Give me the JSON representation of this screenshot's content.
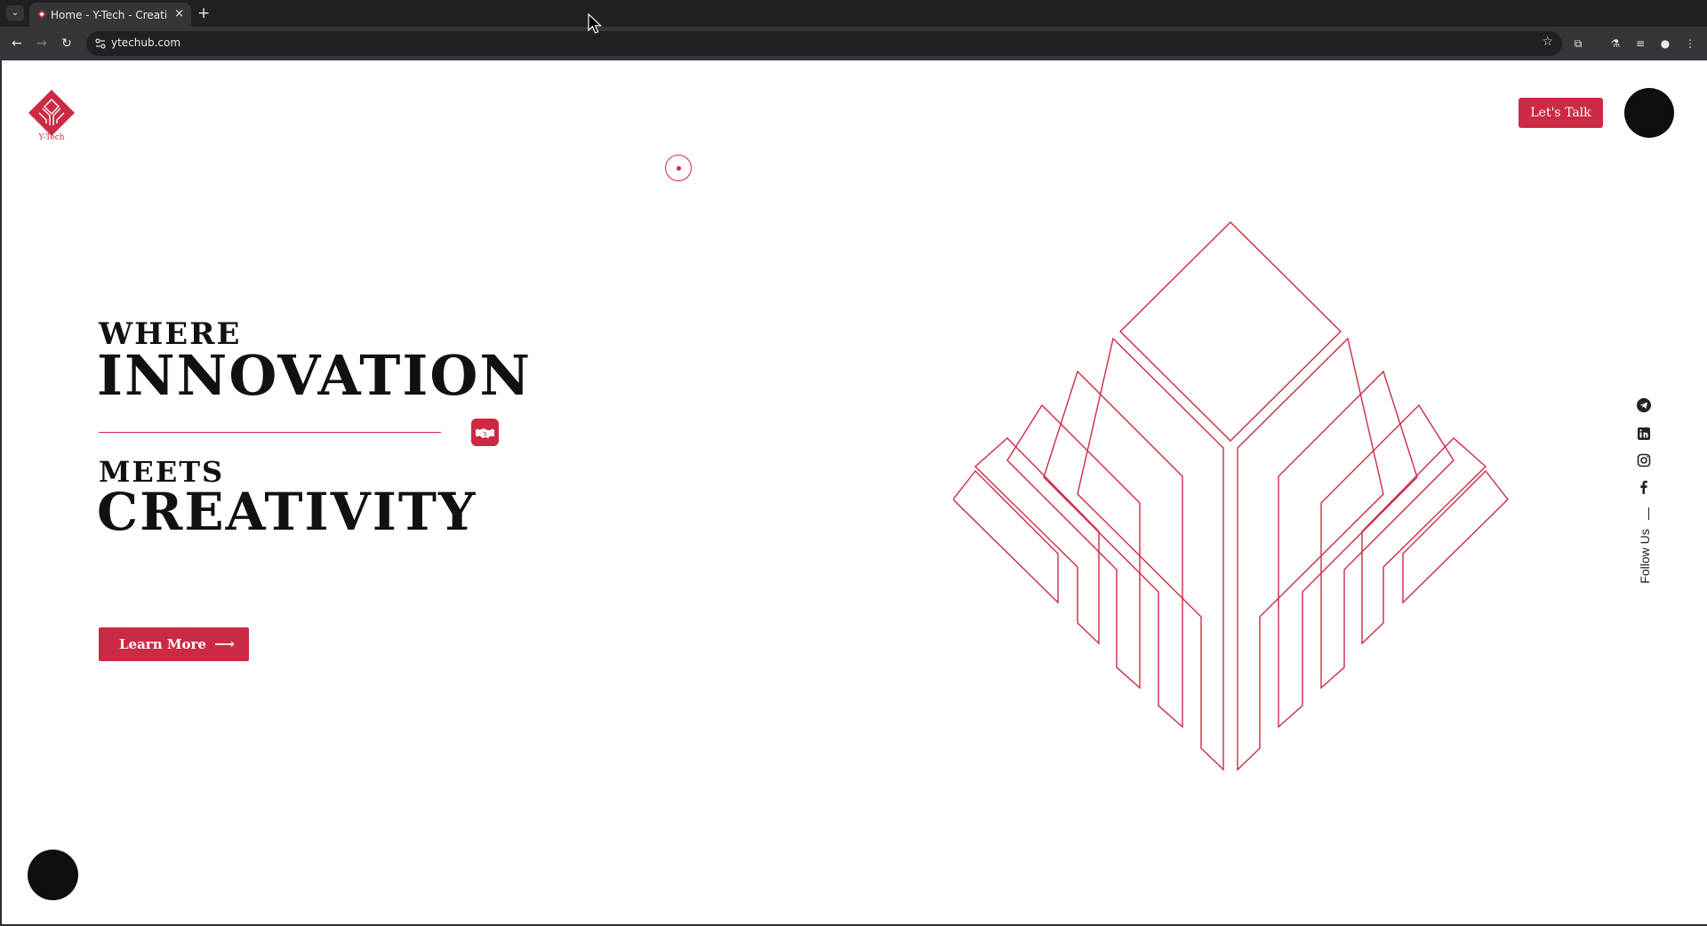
{
  "browser": {
    "tab_title": "Home - Y-Tech - Creative",
    "tab_close": "×",
    "new_tab": "+",
    "url": "ytechub.com",
    "tab_menu": "⌄"
  },
  "header": {
    "logo_text": "Y-Tech",
    "cta_label": "Let's Talk"
  },
  "hero": {
    "line1": "WHERE",
    "line2": "INNOVATION",
    "line3": "MEETS",
    "line4": "CREATIVITY",
    "button_label": "Learn More",
    "button_arrow": "⟶"
  },
  "social": {
    "follow_label": "Follow Us",
    "icons": [
      "telegram-icon",
      "linkedin-icon",
      "instagram-icon",
      "facebook-icon"
    ]
  },
  "colors": {
    "brand": "#cc2a44",
    "dark": "#0f0f0f"
  }
}
